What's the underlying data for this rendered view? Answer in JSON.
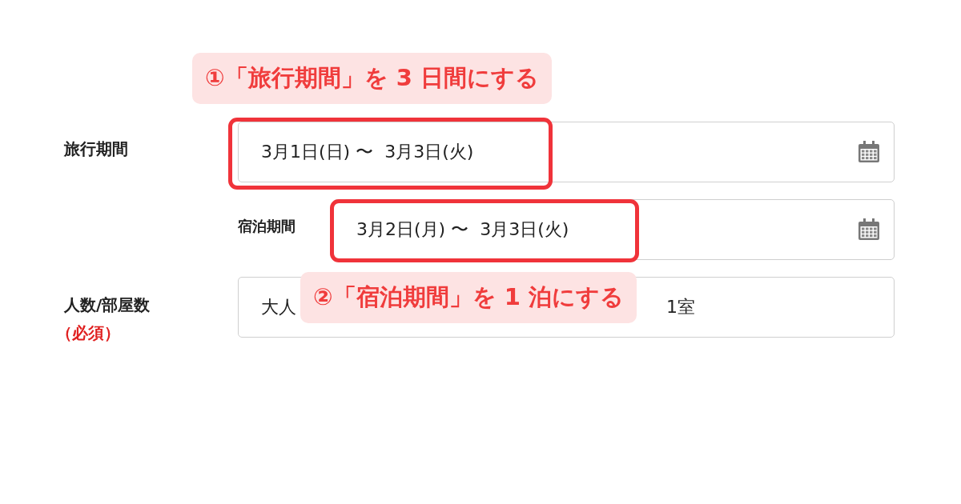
{
  "callouts": [
    {
      "text": "①「旅行期間」を 3 日間にする"
    },
    {
      "text": "②「宿泊期間」を 1 泊にする"
    }
  ],
  "fields": [
    {
      "kind": "date",
      "label": "旅行期間",
      "value": "3月1日(日) 〜  3月3日(火)",
      "highlighted": true
    },
    {
      "kind": "subdate",
      "label": "宿泊期間",
      "value": "3月2日(月) 〜  3月3日(火)",
      "highlighted": true
    },
    {
      "kind": "guests",
      "label": "人数/部屋数",
      "required_label": "（必須）",
      "value": "大人",
      "value_end": "1室"
    }
  ]
}
